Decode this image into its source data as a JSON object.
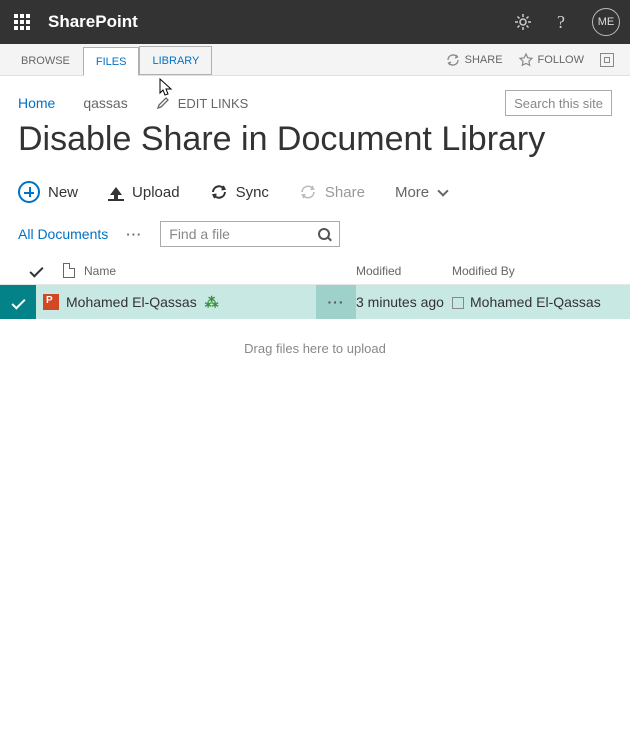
{
  "suite": {
    "app": "SharePoint",
    "me": "ME"
  },
  "ribbon": {
    "tabs": {
      "browse": "BROWSE",
      "files": "FILES",
      "library": "LIBRARY"
    },
    "share": "SHARE",
    "follow": "FOLLOW"
  },
  "nav": {
    "home": "Home",
    "site": "qassas",
    "edit_links": "EDIT LINKS",
    "search_placeholder": "Search this site"
  },
  "page": {
    "title": "Disable Share in Document Library"
  },
  "commands": {
    "new": "New",
    "upload": "Upload",
    "sync": "Sync",
    "share": "Share",
    "more": "More"
  },
  "view": {
    "current": "All Documents",
    "find_placeholder": "Find a file"
  },
  "columns": {
    "name": "Name",
    "modified": "Modified",
    "modified_by": "Modified By"
  },
  "rows": [
    {
      "name": "Mohamed El-Qassas",
      "modified": "3 minutes ago",
      "modified_by": "Mohamed El-Qassas",
      "is_new": true
    }
  ],
  "drop_hint": "Drag files here to upload"
}
